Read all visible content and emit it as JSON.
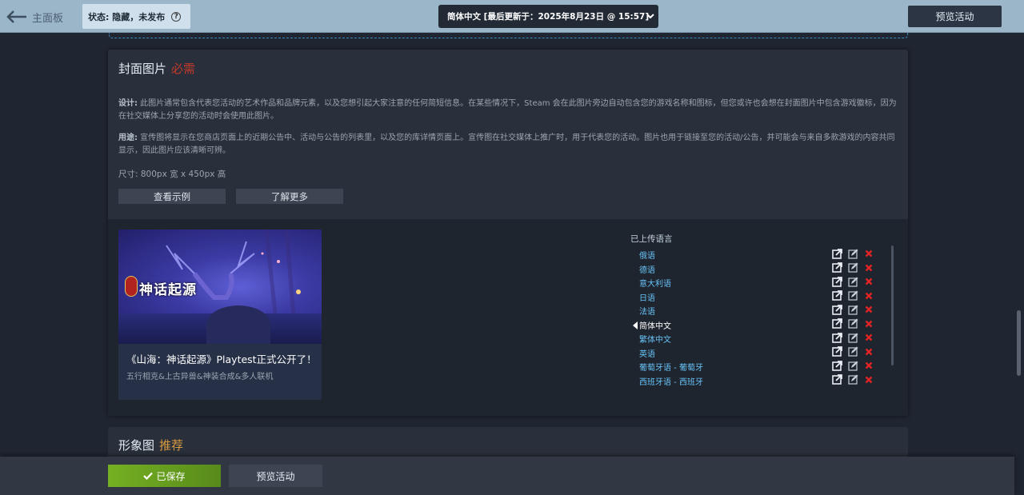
{
  "topbar": {
    "back_label": "主面板",
    "status_label": "状态: 隐藏，未发布",
    "help_glyph": "?",
    "language_select": "简体中文 [最后更新于：2025年8月23日 @ 15:57]",
    "preview_label": "预览活动"
  },
  "cover": {
    "title": "封面图片",
    "required": "必需",
    "design_label": "设计:",
    "design_text": " 此图片通常包含代表您活动的艺术作品和品牌元素，以及您想引起大家注意的任何简短信息。在某些情况下，Steam 会在此图片旁边自动包含您的游戏名称和图标，但您或许也会想在封面图片中包含游戏徽标，因为在社交媒体上分享您的活动时会使用此图片。",
    "usage_label": "用途:",
    "usage_text": " 宣传图将显示在您商店页面上的近期公告中、活动与公告的列表里，以及您的库详情页面上。宣传图在社交媒体上推广时，用于代表您的活动。图片也用于链接至您的活动/公告，并可能会与来自多款游戏的内容共同显示，因此图片应该清晰可辨。",
    "size_text": "尺寸: 800px 宽 x 450px 高",
    "example_button": "查看示例",
    "learn_more_button": "了解更多",
    "card": {
      "logo_text": "神话起源",
      "title": "《山海：神话起源》Playtest正式公开了！",
      "subtitle": "五行相克&上古异兽&神装合成&多人联机"
    },
    "uploaded_heading": "已上传语言",
    "languages": [
      {
        "name": "俄语",
        "active": false
      },
      {
        "name": "德语",
        "active": false
      },
      {
        "name": "意大利语",
        "active": false
      },
      {
        "name": "日语",
        "active": false
      },
      {
        "name": "法语",
        "active": false
      },
      {
        "name": "简体中文",
        "active": true
      },
      {
        "name": "繁体中文",
        "active": false
      },
      {
        "name": "英语",
        "active": false
      },
      {
        "name": "葡萄牙语 - 葡萄牙",
        "active": false
      },
      {
        "name": "西班牙语 - 西班牙",
        "active": false
      }
    ],
    "icons": {
      "open": "open-external-icon",
      "edit": "edit-icon",
      "delete": "delete-icon"
    }
  },
  "image_section": {
    "title": "形象图",
    "recommend": "推荐"
  },
  "bottombar": {
    "saved_label": "已保存",
    "preview_label": "预览活动"
  },
  "colors": {
    "accent_green": "#75b022",
    "required_red": "#c0392b",
    "recommend_orange": "#d89b3f",
    "link_blue": "#67c1f5"
  }
}
